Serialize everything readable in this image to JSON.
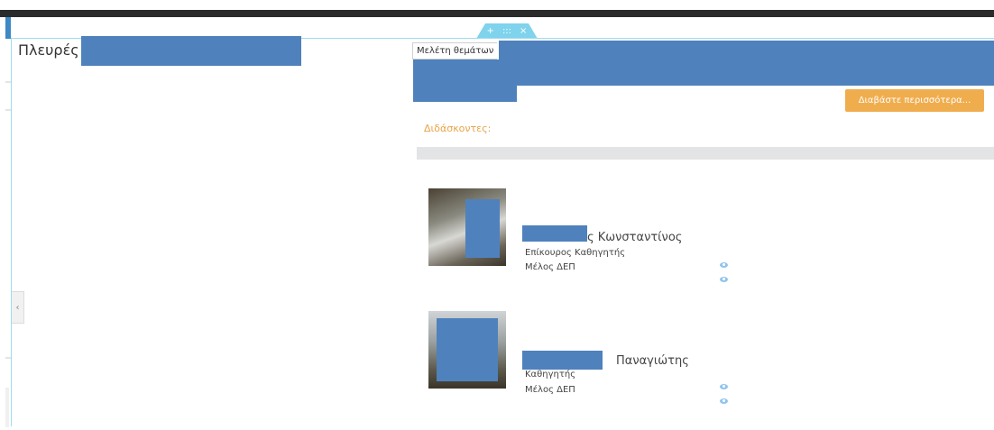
{
  "toolbar": {
    "add_icon": "+",
    "drag_icon": ":::",
    "close_icon": "×"
  },
  "left_panel": {
    "title": "Πλευρές"
  },
  "breadcrumb": {
    "label": "Μελέτη θεμάτων"
  },
  "actions": {
    "read_more": "Διαβάστε περισσότερα..."
  },
  "teachers_section": {
    "label": "Διδάσκοντες:",
    "people": [
      {
        "name_visible": "ς Κωνσταντίνος",
        "rank": "Επίκουρος Καθηγητής",
        "role": "Μέλος ΔΕΠ"
      },
      {
        "name_visible": "Παναγιώτης",
        "rank": "Καθηγητής",
        "role": "Μέλος ΔΕΠ"
      }
    ]
  },
  "collapse_icon": "‹",
  "colors": {
    "accent": "#f0ad4e",
    "redaction": "#4f81bd",
    "frame": "#9fdcee",
    "tab": "#7fd3ec"
  }
}
